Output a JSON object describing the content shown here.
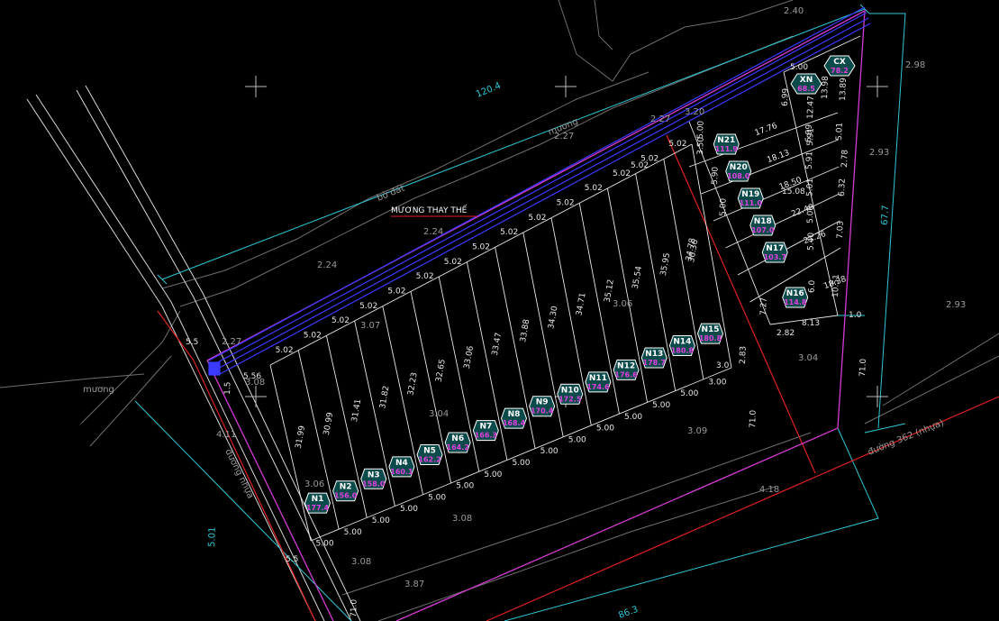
{
  "colors": {
    "background": "#000000",
    "road_edge": "#d8d8d8",
    "terrain": "#6e6e6e",
    "dimension": "#2ec7d6",
    "boundary_red": "#e02020",
    "boundary_magenta": "#d43cd4",
    "canal_blue": "#3a3aff",
    "lot_line": "#e8e8e8",
    "lot_tag_fill": "#0a4a4a",
    "lot_tag_stroke": "#ffffff",
    "lot_area_text": "#e040e0"
  },
  "labels": {
    "canal_note": "MƯƠNG THAY THẾ",
    "canal_top": "mương",
    "canal_left": "mương",
    "bank": "bờ đất",
    "road_left": "đường nhựa",
    "road_right": "đường 362 (nhựa)"
  },
  "dimensions": {
    "d120_4": "120.4",
    "d2_40": "2.40",
    "d67_7": "67.7",
    "d2_98": "2.98",
    "d1_0": "1.0",
    "d71_0a": "71.0",
    "d71_0b": "71.0",
    "d71_0c": "71.0",
    "d1_5": "1.5",
    "d5_5a": "5.5",
    "d5_5b": "5.5",
    "d5_01": "5.01",
    "d86_3": "86.3",
    "d3_0": "3.0",
    "d2_83": "2.83"
  },
  "elevations": [
    {
      "id": "e1",
      "text": "2.24"
    },
    {
      "id": "e2",
      "text": "2.24"
    },
    {
      "id": "e3",
      "text": "2.27"
    },
    {
      "id": "e4",
      "text": "2.27"
    },
    {
      "id": "e5",
      "text": "3.20"
    },
    {
      "id": "e6",
      "text": "2.27"
    },
    {
      "id": "e7",
      "text": "2.93"
    },
    {
      "id": "e8",
      "text": "2.93"
    },
    {
      "id": "e9",
      "text": "3.04"
    },
    {
      "id": "e10",
      "text": "3.09"
    },
    {
      "id": "e11",
      "text": "3.08"
    },
    {
      "id": "e12",
      "text": "3.08"
    },
    {
      "id": "e13",
      "text": "3.87"
    },
    {
      "id": "e14",
      "text": "3.06"
    },
    {
      "id": "e15",
      "text": "3.04"
    },
    {
      "id": "e16",
      "text": "3.07"
    },
    {
      "id": "e17",
      "text": "4.11"
    },
    {
      "id": "e18",
      "text": "4.18"
    },
    {
      "id": "e19",
      "text": "3.08"
    },
    {
      "id": "e20",
      "text": "3.06"
    }
  ],
  "south_lots": [
    {
      "name": "N1",
      "area": "177.4",
      "top_width": "5.02",
      "bottom_width": "5.00",
      "depth": "31.99"
    },
    {
      "name": "N2",
      "area": "156.0",
      "top_width": "5.02",
      "bottom_width": "5.00",
      "depth": "30.99"
    },
    {
      "name": "N3",
      "area": "158.0",
      "top_width": "5.02",
      "bottom_width": "5.00",
      "depth": "31.41"
    },
    {
      "name": "N4",
      "area": "160.1",
      "top_width": "5.02",
      "bottom_width": "5.00",
      "depth": "31.82"
    },
    {
      "name": "N5",
      "area": "162.2",
      "top_width": "5.02",
      "bottom_width": "5.00",
      "depth": "32.23"
    },
    {
      "name": "N6",
      "area": "164.2",
      "top_width": "5.02",
      "bottom_width": "5.00",
      "depth": "32.65"
    },
    {
      "name": "N7",
      "area": "166.3",
      "top_width": "5.02",
      "bottom_width": "5.00",
      "depth": "33.06"
    },
    {
      "name": "N8",
      "area": "168.4",
      "top_width": "5.02",
      "bottom_width": "5.00",
      "depth": "33.47"
    },
    {
      "name": "N9",
      "area": "170.4",
      "top_width": "5.02",
      "bottom_width": "5.00",
      "depth": "33.88"
    },
    {
      "name": "N10",
      "area": "172.5",
      "top_width": "5.02",
      "bottom_width": "5.00",
      "depth": "34.30"
    },
    {
      "name": "N11",
      "area": "174.6",
      "top_width": "5.02",
      "bottom_width": "5.00",
      "depth": "34.71"
    },
    {
      "name": "N12",
      "area": "176.6",
      "top_width": "5.02",
      "bottom_width": "5.00",
      "depth": "35.12"
    },
    {
      "name": "N13",
      "area": "178.7",
      "top_width": "5.02",
      "bottom_width": "5.00",
      "depth": "35.54"
    },
    {
      "name": "N14",
      "area": "180.8",
      "top_width": "5.02",
      "bottom_width": "5.00",
      "depth": "35.95"
    },
    {
      "name": "N15",
      "area": "180.8",
      "top_width": "5.02",
      "bottom_width": "3.00",
      "depth": "36.36"
    }
  ],
  "extra_south": {
    "first_top": "5.56",
    "last_top": "5.02",
    "last_depth": "34.78"
  },
  "east_lots": [
    {
      "name": "N21",
      "area": "111.9",
      "width": "17.76",
      "side": "6.99"
    },
    {
      "name": "N20",
      "area": "108.0",
      "width": "18.13",
      "side": "5.91"
    },
    {
      "name": "N19",
      "area": "111.0",
      "width": "18.50",
      "side": "5.01"
    },
    {
      "name": "N18",
      "area": "107.0",
      "width": "22.40",
      "side": "5.00"
    },
    {
      "name": "N17",
      "area": "103.7",
      "width": "21.26",
      "side": "5.40"
    },
    {
      "name": "N16",
      "area": "114.8",
      "width": "18.38",
      "side": "6.0"
    }
  ],
  "east_misc": {
    "w15_08": "15.08",
    "w8_13": "8.13",
    "w2_82": "2.82",
    "s7_27": "7.27",
    "s10_51": "10.51",
    "s7_03": "7.03",
    "s6_32": "6.32",
    "s2_78": "2.78",
    "s5_01b": "5.01",
    "s5_91b": "5.91",
    "s5_00": "5.00",
    "s5_00b": "5.00",
    "s3_50": "3.50",
    "s5_90": "5.90",
    "s12_47": "12.47",
    "s13_98": "13.98",
    "s13_89": "13.89",
    "s6_99b": "6.99",
    "s5_00c": "5.00"
  },
  "service_lots": [
    {
      "name": "XN",
      "area": "68.5"
    },
    {
      "name": "CX",
      "area": "78.2"
    }
  ]
}
